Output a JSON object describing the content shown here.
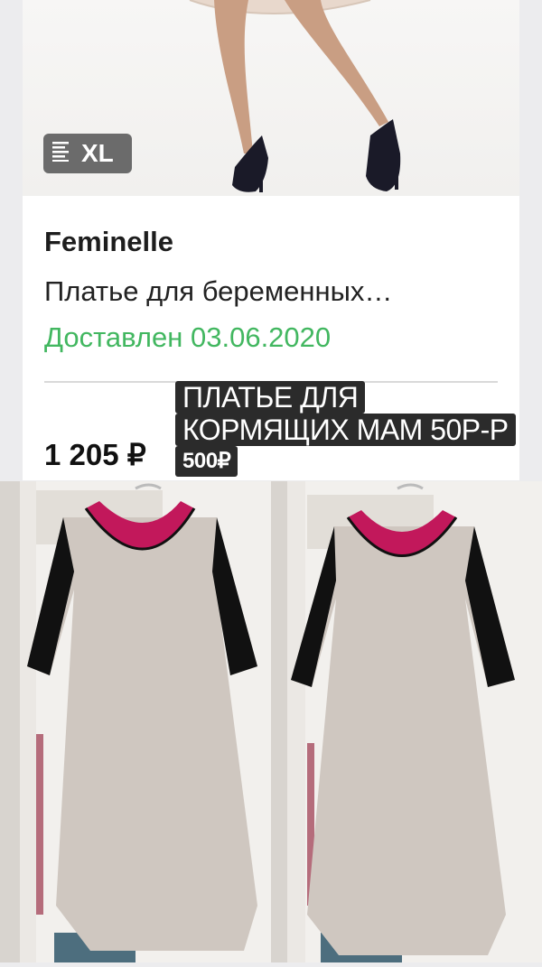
{
  "order": {
    "size_label": "XL",
    "brand": "Feminelle",
    "product_name": "Платье для беременных…",
    "delivery_status": "Доставлен 03.06.2020",
    "price": "1 205 ₽"
  },
  "caption": {
    "line1": "ПЛАТЬЕ ДЛЯ",
    "line2": "КОРМЯЩИХ МАМ 50Р-Р",
    "line3": "500₽"
  },
  "icons": {
    "size": "size-list-icon"
  },
  "colors": {
    "delivered_green": "#42b760",
    "dress_beige": "#cfc7c0",
    "collar_pink": "#c2185b",
    "sleeve_black": "#111111",
    "caption_bg": "#2b2b2b"
  }
}
